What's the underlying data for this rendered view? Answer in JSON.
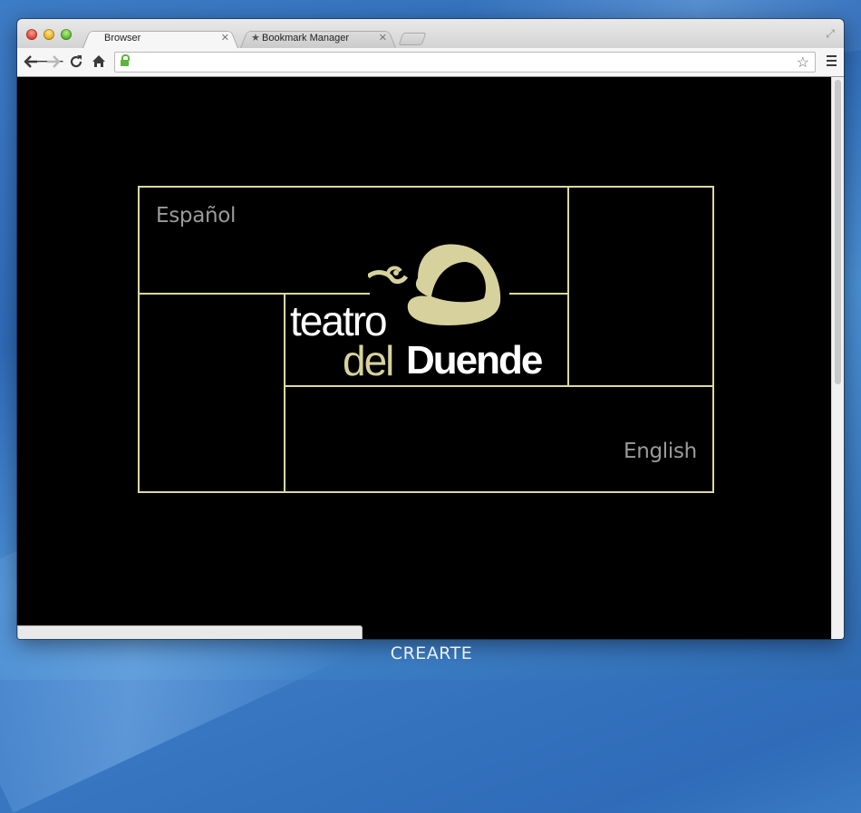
{
  "browser": {
    "tabs": [
      {
        "label": "Browser",
        "active": true
      },
      {
        "label": "Bookmark Manager",
        "active": false
      }
    ],
    "address_value": "",
    "icons": {
      "back": "back-arrow-icon",
      "forward": "forward-arrow-icon",
      "reload": "reload-icon",
      "home": "home-icon",
      "secure": "lock-icon",
      "bookmark": "star-icon",
      "menu": "hamburger-menu-icon",
      "fullscreen": "fullscreen-icon"
    }
  },
  "page": {
    "logo_word1": "teatro",
    "logo_word2": "del",
    "logo_word3": "Duende",
    "lang_spanish": "Español",
    "lang_english": "English",
    "colors": {
      "accent": "#ddd9a0",
      "background": "#000000",
      "lang_text": "#9b9b9b"
    }
  },
  "desktop": {
    "brand": "CREARTE"
  }
}
